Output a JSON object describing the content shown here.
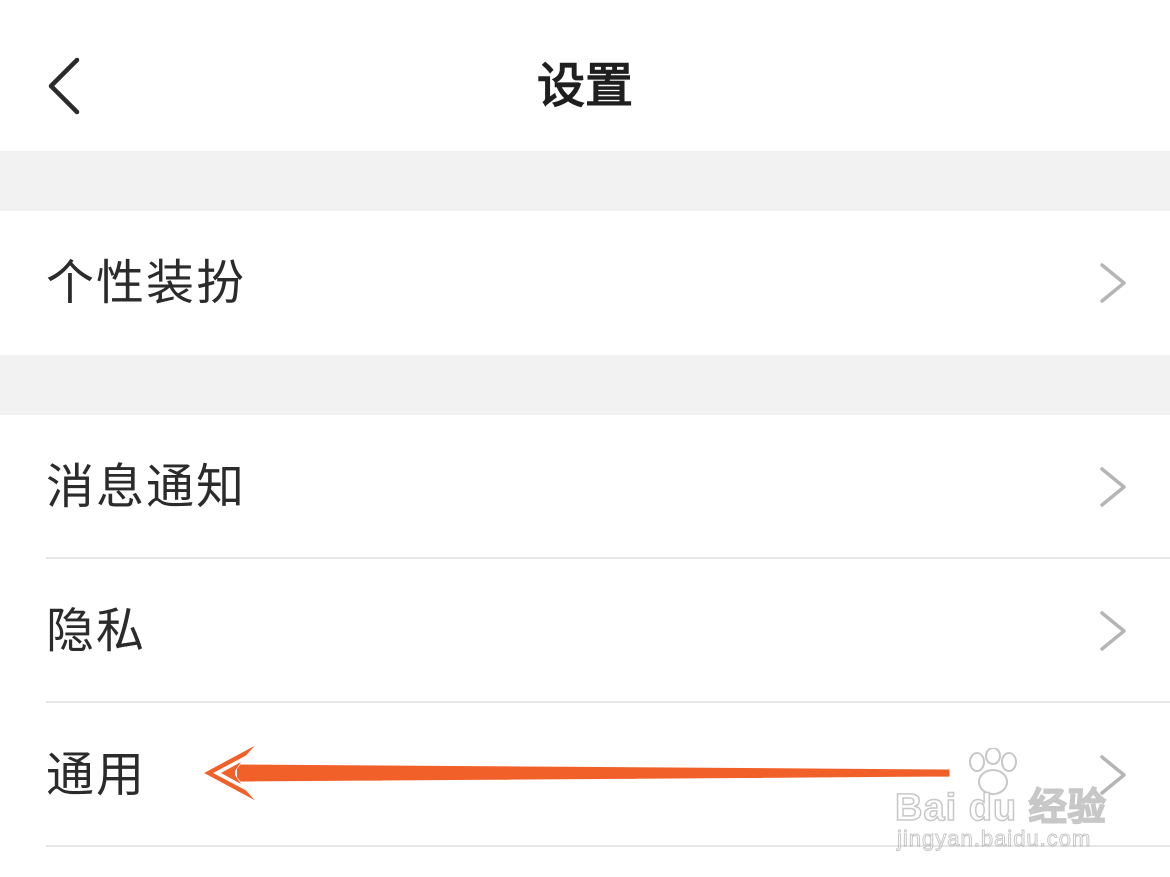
{
  "header": {
    "back_icon": "chevron-left-icon",
    "title": "设置"
  },
  "settings": {
    "items": [
      {
        "label": "个性装扮",
        "icon": "chevron-right-icon"
      },
      {
        "label": "消息通知",
        "icon": "chevron-right-icon"
      },
      {
        "label": "隐私",
        "icon": "chevron-right-icon"
      },
      {
        "label": "通用",
        "icon": "chevron-right-icon"
      }
    ]
  },
  "annotation": {
    "type": "arrow",
    "color": "#f2602a",
    "points_to": "通用"
  },
  "watermark": {
    "brand": "Bai du 经验",
    "url": "jingyan.baidu.com"
  },
  "colors": {
    "background": "#ffffff",
    "section_gap": "#f2f2f2",
    "text": "#2b2b2b",
    "chevron": "#b5b5b5",
    "divider": "#e6e6e6"
  }
}
